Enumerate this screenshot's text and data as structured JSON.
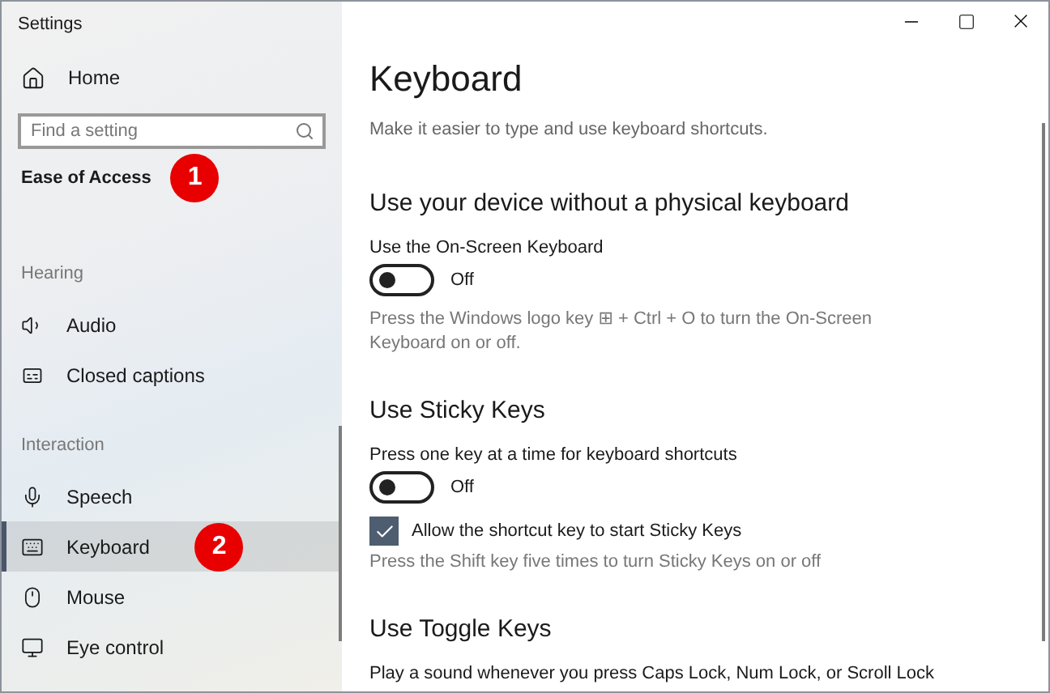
{
  "window": {
    "title": "Settings"
  },
  "sidebar": {
    "home": "Home",
    "search": {
      "placeholder": "Find a setting"
    },
    "category": {
      "label": "Ease of Access",
      "badge": "1"
    },
    "groups": [
      {
        "header": "Hearing",
        "items": [
          {
            "label": "Audio",
            "selected": false
          },
          {
            "label": "Closed captions",
            "selected": false
          }
        ]
      },
      {
        "header": "Interaction",
        "items": [
          {
            "label": "Speech",
            "selected": false
          },
          {
            "label": "Keyboard",
            "selected": true,
            "badge": "2"
          },
          {
            "label": "Mouse",
            "selected": false
          },
          {
            "label": "Eye control",
            "selected": false
          }
        ]
      }
    ]
  },
  "page": {
    "title": "Keyboard",
    "description": "Make it easier to type and use keyboard shortcuts.",
    "sections": [
      {
        "heading": "Use your device without a physical keyboard",
        "controls": [
          {
            "kind": "toggle",
            "label": "Use the On-Screen Keyboard",
            "on": false,
            "state_text": "Off"
          },
          {
            "kind": "help",
            "text": "Press the Windows logo key ⊞ + Ctrl + O to turn the On-Screen Keyboard on or off."
          }
        ]
      },
      {
        "heading": "Use Sticky Keys",
        "controls": [
          {
            "kind": "toggle",
            "label": "Press one key at a time for keyboard shortcuts",
            "on": false,
            "state_text": "Off"
          },
          {
            "kind": "checkbox",
            "label": "Allow the shortcut key to start Sticky Keys",
            "checked": true
          },
          {
            "kind": "help",
            "text": "Press the Shift key five times to turn Sticky Keys on or off"
          }
        ]
      },
      {
        "heading": "Use Toggle Keys",
        "controls": [
          {
            "kind": "label",
            "text": "Play a sound whenever you press Caps Lock, Num Lock, or Scroll Lock"
          }
        ]
      }
    ]
  }
}
